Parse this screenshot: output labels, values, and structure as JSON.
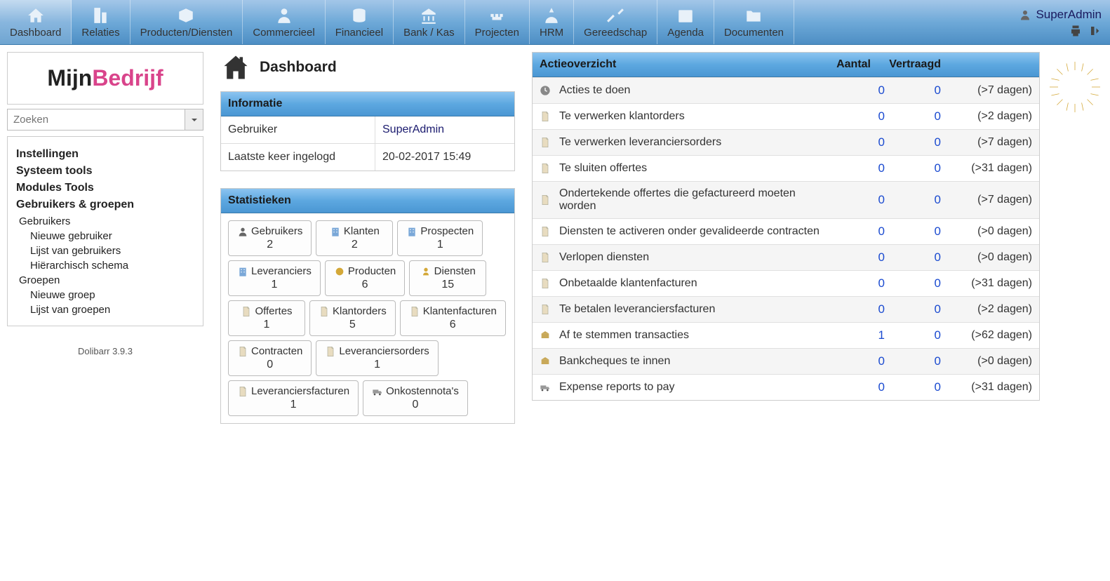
{
  "topnav": [
    {
      "label": "Dashboard",
      "icon": "home",
      "active": true
    },
    {
      "label": "Relaties",
      "icon": "building"
    },
    {
      "label": "Producten/Diensten",
      "icon": "box"
    },
    {
      "label": "Commercieel",
      "icon": "person"
    },
    {
      "label": "Financieel",
      "icon": "coins"
    },
    {
      "label": "Bank / Kas",
      "icon": "bank"
    },
    {
      "label": "Projecten",
      "icon": "project"
    },
    {
      "label": "HRM",
      "icon": "hrm"
    },
    {
      "label": "Gereedschap",
      "icon": "tools"
    },
    {
      "label": "Agenda",
      "icon": "calendar"
    },
    {
      "label": "Documenten",
      "icon": "folder"
    }
  ],
  "user": {
    "name": "SuperAdmin"
  },
  "logo": {
    "part1": "Mijn",
    "part2": "Bedrijf"
  },
  "search": {
    "placeholder": "Zoeken"
  },
  "sidemenu": {
    "sections": [
      {
        "title": "Instellingen"
      },
      {
        "title": "Systeem tools"
      },
      {
        "title": "Modules Tools"
      },
      {
        "title": "Gebruikers & groepen",
        "children": [
          {
            "label": "Gebruikers",
            "level": 1
          },
          {
            "label": "Nieuwe gebruiker",
            "level": 2
          },
          {
            "label": "Lijst van gebruikers",
            "level": 2
          },
          {
            "label": "Hiërarchisch schema",
            "level": 2
          },
          {
            "label": "Groepen",
            "level": 1
          },
          {
            "label": "Nieuwe groep",
            "level": 2
          },
          {
            "label": "Lijst van groepen",
            "level": 2
          }
        ]
      }
    ]
  },
  "version": "Dolibarr 3.9.3",
  "page_title": "Dashboard",
  "info_panel": {
    "title": "Informatie",
    "rows": [
      {
        "label": "Gebruiker",
        "value": "SuperAdmin",
        "link": true
      },
      {
        "label": "Laatste keer ingelogd",
        "value": "20-02-2017 15:49",
        "link": false
      }
    ]
  },
  "stats_panel": {
    "title": "Statistieken",
    "items": [
      {
        "label": "Gebruikers",
        "value": "2",
        "icon": "user"
      },
      {
        "label": "Klanten",
        "value": "2",
        "icon": "building2"
      },
      {
        "label": "Prospecten",
        "value": "1",
        "icon": "building2"
      },
      {
        "label": "Leveranciers",
        "value": "1",
        "icon": "building2"
      },
      {
        "label": "Producten",
        "value": "6",
        "icon": "product"
      },
      {
        "label": "Diensten",
        "value": "15",
        "icon": "service"
      },
      {
        "label": "Offertes",
        "value": "1",
        "icon": "doc"
      },
      {
        "label": "Klantorders",
        "value": "5",
        "icon": "doc"
      },
      {
        "label": "Klantenfacturen",
        "value": "6",
        "icon": "doc"
      },
      {
        "label": "Contracten",
        "value": "0",
        "icon": "doc"
      },
      {
        "label": "Leveranciersorders",
        "value": "1",
        "icon": "doc"
      },
      {
        "label": "Leveranciersfacturen",
        "value": "1",
        "icon": "doc"
      },
      {
        "label": "Onkostennota's",
        "value": "0",
        "icon": "truck"
      }
    ]
  },
  "action_panel": {
    "title": "Actieoverzicht",
    "col_aantal": "Aantal",
    "col_vertraagd": "Vertraagd",
    "rows": [
      {
        "icon": "clock",
        "label": "Acties te doen",
        "aantal": "0",
        "vertraagd": "0",
        "delay": "(>7 dagen)"
      },
      {
        "icon": "doc",
        "label": "Te verwerken klantorders",
        "aantal": "0",
        "vertraagd": "0",
        "delay": "(>2 dagen)"
      },
      {
        "icon": "doc",
        "label": "Te verwerken leveranciersorders",
        "aantal": "0",
        "vertraagd": "0",
        "delay": "(>7 dagen)"
      },
      {
        "icon": "doc",
        "label": "Te sluiten offertes",
        "aantal": "0",
        "vertraagd": "0",
        "delay": "(>31 dagen)"
      },
      {
        "icon": "doc",
        "label": "Ondertekende offertes die gefactureerd moeten worden",
        "aantal": "0",
        "vertraagd": "0",
        "delay": "(>7 dagen)"
      },
      {
        "icon": "doc",
        "label": "Diensten te activeren onder gevalideerde contracten",
        "aantal": "0",
        "vertraagd": "0",
        "delay": "(>0 dagen)"
      },
      {
        "icon": "doc",
        "label": "Verlopen diensten",
        "aantal": "0",
        "vertraagd": "0",
        "delay": "(>0 dagen)"
      },
      {
        "icon": "doc",
        "label": "Onbetaalde klantenfacturen",
        "aantal": "0",
        "vertraagd": "0",
        "delay": "(>31 dagen)"
      },
      {
        "icon": "doc",
        "label": "Te betalen leveranciersfacturen",
        "aantal": "0",
        "vertraagd": "0",
        "delay": "(>2 dagen)"
      },
      {
        "icon": "bank2",
        "label": "Af te stemmen transacties",
        "aantal": "1",
        "vertraagd": "0",
        "delay": "(>62 dagen)"
      },
      {
        "icon": "bank2",
        "label": "Bankcheques te innen",
        "aantal": "0",
        "vertraagd": "0",
        "delay": "(>0 dagen)"
      },
      {
        "icon": "truck",
        "label": "Expense reports to pay",
        "aantal": "0",
        "vertraagd": "0",
        "delay": "(>31 dagen)"
      }
    ]
  }
}
